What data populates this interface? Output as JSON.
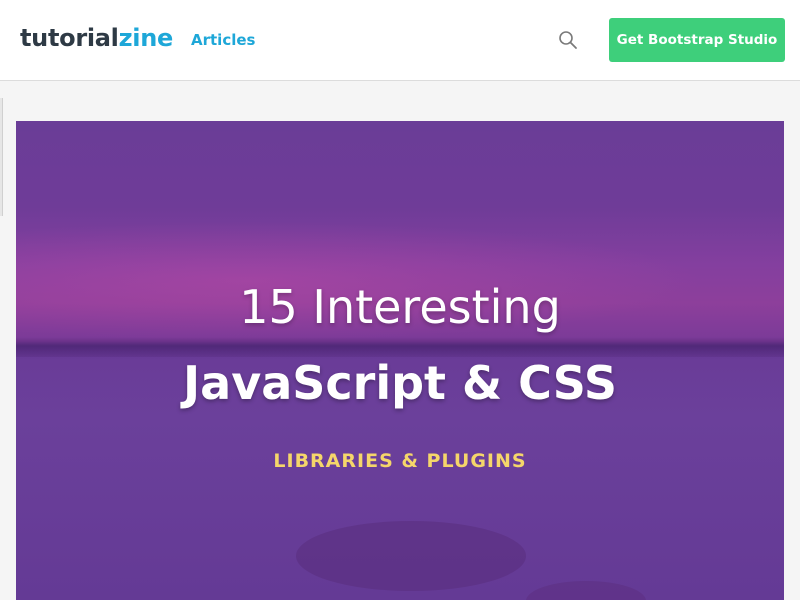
{
  "header": {
    "logo_part1": "tutorial",
    "logo_part2": "zine",
    "nav_articles": "Articles",
    "cta_label": "Get Bootstrap Studio",
    "search_icon": "search-icon"
  },
  "hero": {
    "line1": "15 Interesting",
    "line2": "JavaScript & CSS",
    "line3": "LIBRARIES & PLUGINS"
  },
  "colors": {
    "brand_dark": "#2e3a45",
    "brand_blue": "#1ea7d8",
    "cta_green": "#3ecf7b",
    "hero_purple": "#6a3d97",
    "hero_accent_yellow": "#f5d66a"
  }
}
